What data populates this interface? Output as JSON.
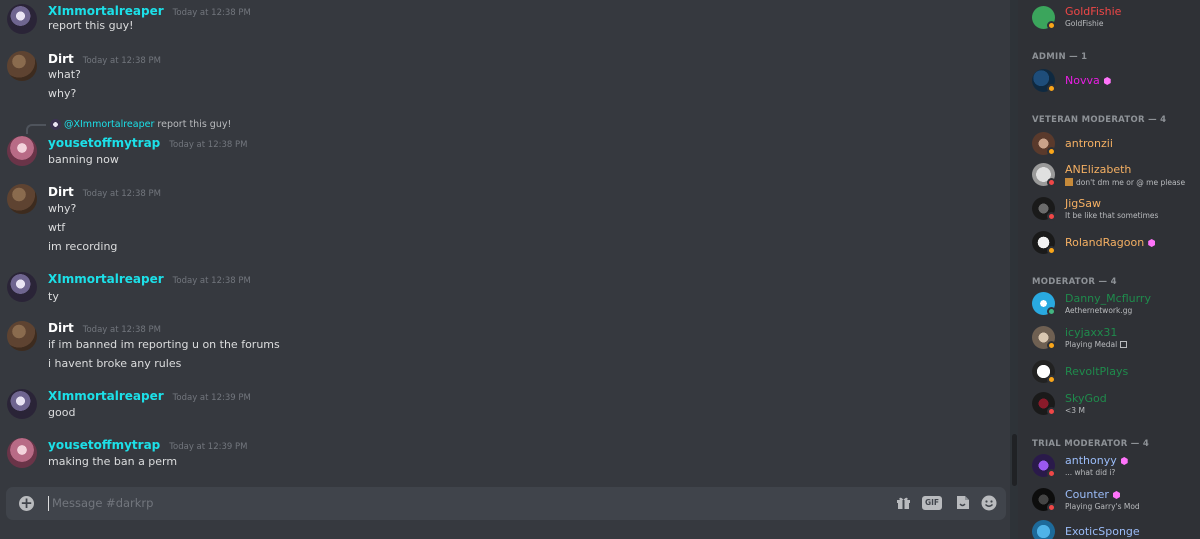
{
  "channel": {
    "composer_placeholder": "Message #darkrp"
  },
  "colors": {
    "reaper": "#1ce0e8",
    "dirt": "#ffffff",
    "trap": "#1ce0e8",
    "background": "#36393f",
    "sidebar": "#2f3136"
  },
  "messages": [
    {
      "author": "XImmortalreaper",
      "timestamp": "Today at 12:38 PM",
      "lines": [
        "report this guy!"
      ]
    },
    {
      "author": "Dirt",
      "timestamp": "Today at 12:38 PM",
      "lines": [
        "what?",
        "why?"
      ]
    },
    {
      "reply_to": {
        "mention": "@XImmortalreaper",
        "text": "report this guy!"
      },
      "author": "yousetoffmytrap",
      "timestamp": "Today at 12:38 PM",
      "lines": [
        "banning now"
      ]
    },
    {
      "author": "Dirt",
      "timestamp": "Today at 12:38 PM",
      "lines": [
        "why?",
        "wtf",
        "im recording"
      ]
    },
    {
      "author": "XImmortalreaper",
      "timestamp": "Today at 12:38 PM",
      "lines": [
        "ty"
      ]
    },
    {
      "author": "Dirt",
      "timestamp": "Today at 12:38 PM",
      "lines": [
        "if im banned im reporting u on the forums",
        "i havent broke any rules"
      ]
    },
    {
      "author": "XImmortalreaper",
      "timestamp": "Today at 12:39 PM",
      "lines": [
        "good"
      ]
    },
    {
      "author": "yousetoffmytrap",
      "timestamp": "Today at 12:39 PM",
      "lines": [
        "making the ban  a perm"
      ]
    }
  ],
  "composer": {
    "plus_icon": "plus-circle-icon",
    "gift_icon": "gift-icon",
    "gif_label": "GIF",
    "sticker_icon": "sticker-icon",
    "emoji_icon": "emoji-icon"
  },
  "members": {
    "top": [
      {
        "name": "GoldFishie",
        "sub": "GoldFishie",
        "color": "#f04747",
        "status": "idle"
      }
    ],
    "categories": [
      {
        "label": "ADMIN — 1",
        "members": [
          {
            "name": "Novva",
            "color": "#e91ee3",
            "status": "idle",
            "boost": true
          }
        ]
      },
      {
        "label": "VETERAN MODERATOR — 4",
        "members": [
          {
            "name": "antronzii",
            "color": "#f5b063",
            "status": "idle"
          },
          {
            "name": "ANElizabeth",
            "sub": "don't dm me or @ me please",
            "color": "#f5b063",
            "status": "dnd"
          },
          {
            "name": "JigSaw",
            "sub": "It be like that sometimes",
            "color": "#f5b063",
            "status": "dnd"
          },
          {
            "name": "RolandRagoon",
            "color": "#f5b063",
            "status": "idle",
            "boost": true
          }
        ]
      },
      {
        "label": "MODERATOR — 4",
        "members": [
          {
            "name": "Danny_Mcflurry",
            "sub": "Aethernetwork.gg",
            "color": "#1f8b4c",
            "status": "online"
          },
          {
            "name": "icyjaxx31",
            "sub": "Playing Medal",
            "color": "#1f8b4c",
            "status": "idle"
          },
          {
            "name": "RevoltPlays",
            "color": "#1f8b4c",
            "status": "idle"
          },
          {
            "name": "SkyGod",
            "sub": "<3 M",
            "color": "#1f8b4c",
            "status": "dnd"
          }
        ]
      },
      {
        "label": "TRIAL MODERATOR — 4",
        "members": [
          {
            "name": "anthonyy",
            "sub": "... what did i?",
            "color": "#9bbcf8",
            "status": "dnd",
            "boost": true
          },
          {
            "name": "Counter",
            "sub": "Playing Garry's Mod",
            "color": "#9bbcf8",
            "status": "dnd",
            "boost": true
          },
          {
            "name": "ExoticSponge",
            "color": "#9bbcf8",
            "status": "idle"
          }
        ]
      }
    ]
  }
}
